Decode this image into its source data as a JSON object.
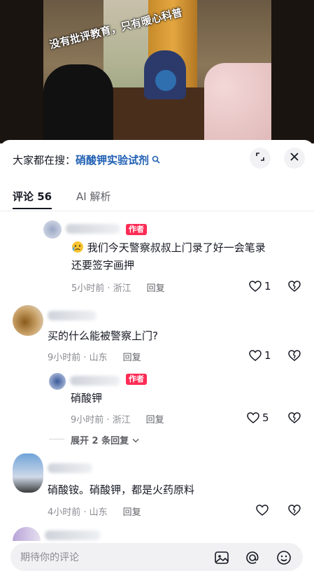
{
  "video": {
    "caption": "没有批评教育，只有暖心科普"
  },
  "sheet": {
    "search_prefix": "大家都在搜：",
    "search_keyword": "硝酸钾实验试剂",
    "tabs": [
      {
        "label": "评论 56",
        "active": true
      },
      {
        "label": "AI 解析",
        "active": false
      }
    ]
  },
  "comments": [
    {
      "author_tag": "作者",
      "text_line1": "我们今天警察叔叔上门录了好一会笔录",
      "text_line2": "还要签字画押",
      "time": "5小时前 · 浙江",
      "reply": "回复",
      "likes": "1"
    },
    {
      "text": "买的什么能被警察上门?",
      "time": "9小时前 · 山东",
      "reply": "回复",
      "likes": "1"
    },
    {
      "author_tag": "作者",
      "text": "硝酸钾",
      "time": "9小时前 · 浙江",
      "reply": "回复",
      "likes": "5"
    },
    {
      "expand": "展开 2 条回复"
    },
    {
      "text": "硝酸铵。硝酸钾，都是火药原料",
      "time": "4小时前 · 山东",
      "reply": "回复"
    }
  ],
  "input": {
    "placeholder": "期待你的评论"
  },
  "colors": {
    "accent_red": "#fe2c55",
    "link_blue": "#1f5fb3"
  },
  "icons": [
    "expand-icon",
    "close-icon",
    "heart-icon",
    "broken-heart-icon",
    "image-icon",
    "mention-icon",
    "emoji-icon",
    "chevron-down-icon",
    "crying-emoji-icon",
    "search-icon"
  ]
}
